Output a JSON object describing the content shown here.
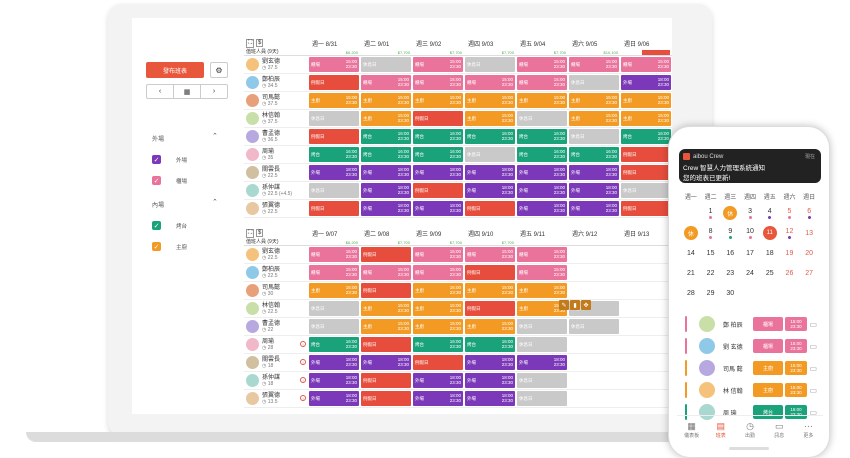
{
  "sidebar": {
    "publish_label": "發布班表",
    "section_outer": "外場",
    "section_inner": "內場",
    "outer_items": [
      {
        "label": "外場",
        "color": "#7b38b8"
      },
      {
        "label": "櫃場",
        "color": "#e9739b"
      }
    ],
    "inner_items": [
      {
        "label": "烤台",
        "color": "#1aa37a"
      },
      {
        "label": "主廚",
        "color": "#f29a23"
      }
    ]
  },
  "week1": {
    "count_label": "值班人員 (9天)",
    "days": [
      {
        "label": "週一 8/31",
        "amt": "$6,200"
      },
      {
        "label": "週二 9/01",
        "amt": "$7,700"
      },
      {
        "label": "週三 9/02",
        "amt": "$7,700"
      },
      {
        "label": "週四 9/03",
        "amt": "$7,700"
      },
      {
        "label": "週五 9/04",
        "amt": "$7,700"
      },
      {
        "label": "週六 9/05",
        "amt": "$10,100"
      },
      {
        "label": "週日 9/06",
        "amt": "$7,700 (+1,371)"
      }
    ],
    "employees": [
      {
        "name": "劉玄德",
        "hrs": "37.5"
      },
      {
        "name": "鄭柏辰",
        "hrs": "34.5"
      },
      {
        "name": "司馬懿",
        "hrs": "37.5"
      },
      {
        "name": "林信翰",
        "hrs": "37.5"
      },
      {
        "name": "曹孟德",
        "hrs": "36.5"
      },
      {
        "name": "周瑜",
        "hrs": "35"
      },
      {
        "name": "關雲長",
        "hrs": "22.5"
      },
      {
        "name": "孫仲謀",
        "hrs": "22.5 (+4.5)"
      },
      {
        "name": "張翼德",
        "hrs": "22.5"
      }
    ]
  },
  "week2": {
    "count_label": "值班人員 (9天)",
    "days": [
      {
        "label": "週一 9/07",
        "amt": "$6,200"
      },
      {
        "label": "週二 9/08",
        "amt": "$7,700"
      },
      {
        "label": "週三 9/09",
        "amt": "$7,700"
      },
      {
        "label": "週四 9/10",
        "amt": "$7,700"
      },
      {
        "label": "週五 9/11",
        "amt": ""
      },
      {
        "label": "週六 9/12",
        "amt": ""
      },
      {
        "label": "週日 9/13",
        "amt": ""
      }
    ],
    "employees": [
      {
        "name": "劉玄德",
        "hrs": "22.5"
      },
      {
        "name": "鄭柏辰",
        "hrs": "22.5"
      },
      {
        "name": "司馬懿",
        "hrs": "30"
      },
      {
        "name": "林信翰",
        "hrs": "22.5"
      },
      {
        "name": "曹孟德",
        "hrs": "22"
      },
      {
        "name": "周瑜",
        "hrs": "28"
      },
      {
        "name": "關雲長",
        "hrs": "18"
      },
      {
        "name": "孫仲謀",
        "hrs": "18"
      },
      {
        "name": "張翼德",
        "hrs": "13.5"
      }
    ]
  },
  "shift_times": {
    "start": "15:00",
    "end": "23:30",
    "start2": "16:00",
    "start3": "18:00"
  },
  "shift_labels": {
    "pink": "櫃場",
    "purple": "外場",
    "orange": "主廚",
    "green": "烤台",
    "gray": "休息日",
    "red": "例假日"
  },
  "phone": {
    "app_name": "aibou Crew",
    "time": "現在",
    "notif_title": "Crew 智慧人力管理系統通知",
    "notif_body": "您的班表已更新!",
    "weekdays": [
      "週一",
      "週二",
      "週三",
      "週四",
      "週五",
      "週六",
      "週日"
    ],
    "cal_rows": [
      [
        "",
        "1",
        "2",
        "3",
        "4",
        "5",
        "6"
      ],
      [
        "7",
        "8",
        "9",
        "10",
        "11",
        "12",
        "13"
      ],
      [
        "14",
        "15",
        "16",
        "17",
        "18",
        "19",
        "20"
      ],
      [
        "21",
        "22",
        "23",
        "24",
        "25",
        "26",
        "27"
      ],
      [
        "28",
        "29",
        "30",
        "",
        "",
        "",
        ""
      ]
    ],
    "badge_rest": "休",
    "list": [
      {
        "name": "鄭 柏辰",
        "shift": "櫃場",
        "color": "#e9739b"
      },
      {
        "name": "劉 玄德",
        "shift": "櫃場",
        "color": "#e9739b"
      },
      {
        "name": "司馬 懿",
        "shift": "主廚",
        "color": "#f29a23"
      },
      {
        "name": "林 信翰",
        "shift": "主廚",
        "color": "#f29a23"
      },
      {
        "name": "周 瑜",
        "shift": "烤台",
        "color": "#1aa37a"
      }
    ],
    "tabs": [
      "儀表板",
      "班表",
      "出勤",
      "訊息",
      "更多"
    ]
  }
}
